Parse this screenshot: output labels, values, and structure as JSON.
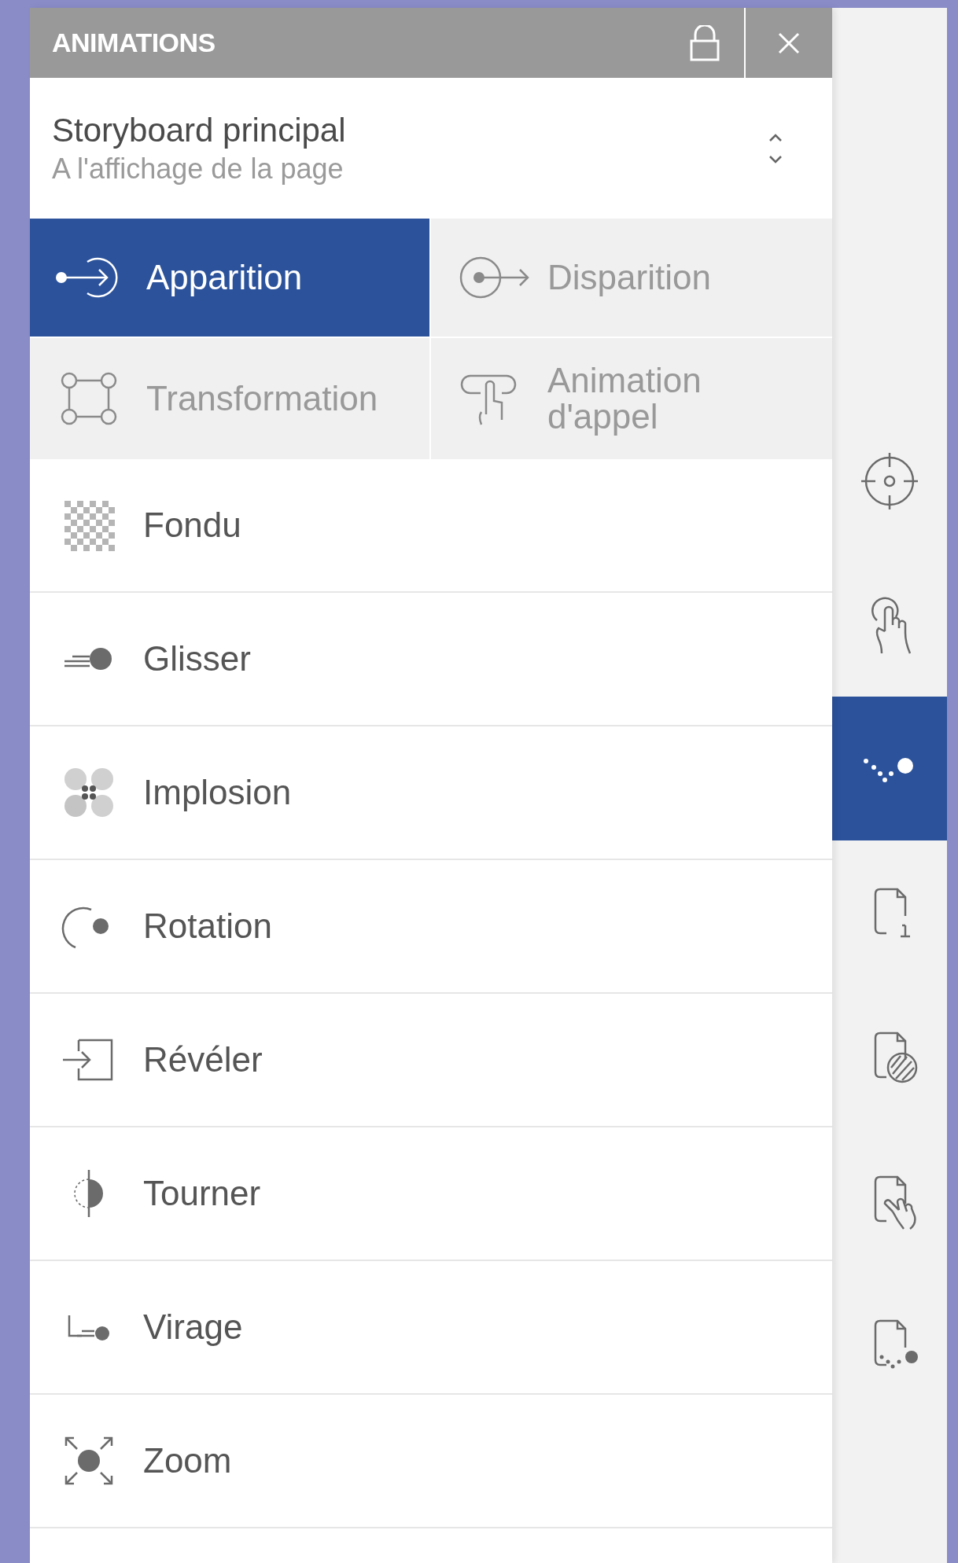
{
  "panel": {
    "title": "ANIMATIONS"
  },
  "storyboard": {
    "name": "Storyboard principal",
    "trigger": "A l'affichage de la page"
  },
  "tabs": [
    {
      "label": "Apparition",
      "kind": "appear",
      "selected": true
    },
    {
      "label": "Disparition",
      "kind": "disappear",
      "selected": false
    },
    {
      "label": "Transformation",
      "kind": "transform",
      "selected": false
    },
    {
      "label": "Animation d'appel",
      "kind": "attention",
      "selected": false
    }
  ],
  "effects": [
    {
      "label": "Fondu",
      "kind": "fade"
    },
    {
      "label": "Glisser",
      "kind": "slide"
    },
    {
      "label": "Implosion",
      "kind": "implode"
    },
    {
      "label": "Rotation",
      "kind": "rotate"
    },
    {
      "label": "Révéler",
      "kind": "reveal"
    },
    {
      "label": "Tourner",
      "kind": "flip"
    },
    {
      "label": "Virage",
      "kind": "turn"
    },
    {
      "label": "Zoom",
      "kind": "zoom"
    }
  ],
  "sidebar": {
    "items": [
      {
        "kind": "target",
        "selected": false
      },
      {
        "kind": "touch",
        "selected": false
      },
      {
        "kind": "motion",
        "selected": true
      },
      {
        "kind": "page-info",
        "selected": false
      },
      {
        "kind": "page-pattern",
        "selected": false
      },
      {
        "kind": "page-touch",
        "selected": false
      },
      {
        "kind": "page-motion",
        "selected": false
      }
    ]
  }
}
